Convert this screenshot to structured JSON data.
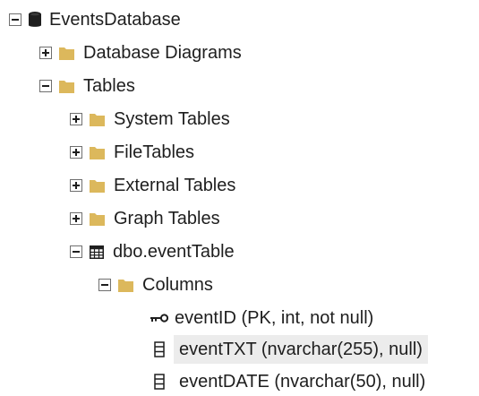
{
  "tree": {
    "database": {
      "label": "EventsDatabase",
      "expanded": true,
      "icon": "database-icon"
    },
    "database_diagrams": {
      "label": "Database Diagrams",
      "expanded": false,
      "icon": "folder-icon"
    },
    "tables": {
      "label": "Tables",
      "expanded": true,
      "icon": "folder-icon"
    },
    "system_tables": {
      "label": "System Tables",
      "expanded": false,
      "icon": "folder-icon"
    },
    "file_tables": {
      "label": "FileTables",
      "expanded": false,
      "icon": "folder-icon"
    },
    "external_tables": {
      "label": "External Tables",
      "expanded": false,
      "icon": "folder-icon"
    },
    "graph_tables": {
      "label": "Graph Tables",
      "expanded": false,
      "icon": "folder-icon"
    },
    "event_table": {
      "label": "dbo.eventTable",
      "expanded": true,
      "icon": "table-icon"
    },
    "columns_folder": {
      "label": "Columns",
      "expanded": true,
      "icon": "folder-icon"
    },
    "columns": [
      {
        "label": "eventID (PK, int, not null)",
        "icon": "key-icon",
        "selected": false
      },
      {
        "label": "eventTXT (nvarchar(255), null)",
        "icon": "column-icon",
        "selected": true
      },
      {
        "label": "eventDATE (nvarchar(50), null)",
        "icon": "column-icon",
        "selected": false
      }
    ]
  },
  "colors": {
    "folder": "#dcb85c",
    "selection": "#ececec",
    "text": "#1e1e1e",
    "expander_border": "#6f6f6f"
  }
}
